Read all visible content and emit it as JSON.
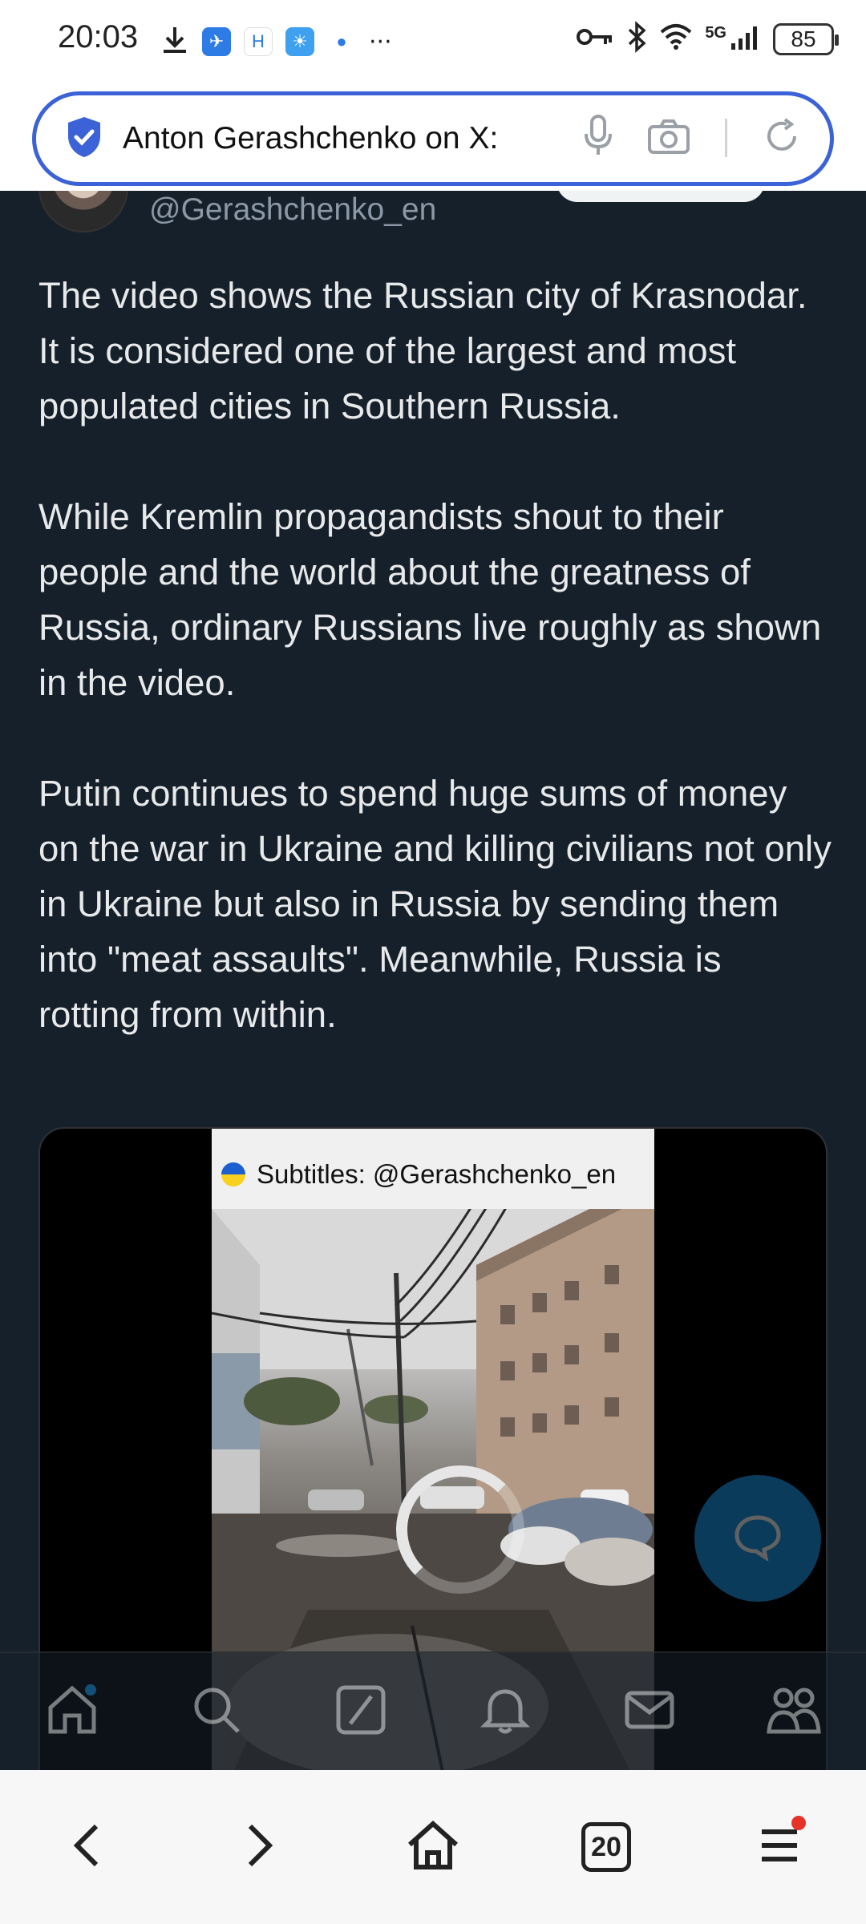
{
  "status_bar": {
    "time": "20:03",
    "network": "5G",
    "battery": "85"
  },
  "address_bar": {
    "title": "Anton Gerashchenko on X:"
  },
  "tweet": {
    "handle": "@Gerashchenko_en",
    "paragraphs": [
      "The video shows the Russian city of Krasnodar. It is considered one of the largest and most populated cities in Southern Russia.",
      "While Kremlin propagandists shout to their people and the world about the greatness of Russia, ordinary Russians live roughly as shown in the video.",
      "Putin continues to spend huge sums of money on the war in Ukraine and killing civilians not only in Ukraine but also in Russia by sending them into \"meat assaults\". Meanwhile, Russia is rotting from within."
    ],
    "video_subtitle": "Subtitles: @Gerashchenko_en"
  },
  "x_nav": {
    "items": [
      "home-icon",
      "search-icon",
      "grok-icon",
      "notifications-icon",
      "messages-icon",
      "communities-icon"
    ]
  },
  "browser_bar": {
    "tabs_count": "20"
  },
  "colors": {
    "background": "#16202b",
    "accent": "#1d9bf0",
    "address_border": "#3b62d6",
    "text": "#e7e9ea",
    "handle": "#8b98a5"
  }
}
